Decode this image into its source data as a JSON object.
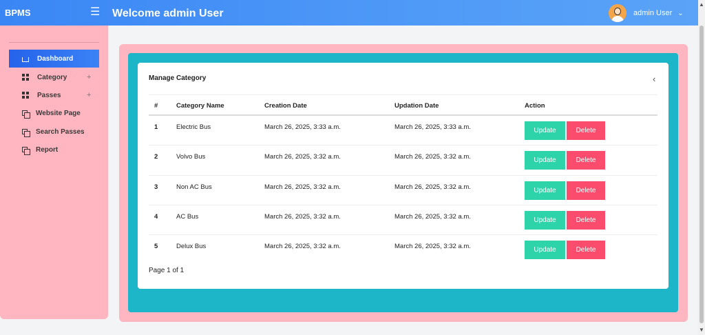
{
  "header": {
    "brand": "BPMS",
    "welcome": "Welcome  admin User",
    "user_name": "admin User"
  },
  "sidebar": {
    "items": [
      {
        "label": "Dashboard",
        "icon": "home-icon",
        "active": true
      },
      {
        "label": "Category",
        "icon": "grid-icon",
        "expandable": true
      },
      {
        "label": "Passes",
        "icon": "grid-icon",
        "expandable": true
      },
      {
        "label": "Website Page",
        "icon": "copy-icon"
      },
      {
        "label": "Search Passes",
        "icon": "copy-icon"
      },
      {
        "label": "Report",
        "icon": "copy-icon"
      }
    ],
    "plus": "+"
  },
  "card": {
    "title": "Manage Category",
    "columns": [
      "#",
      "Category Name",
      "Creation Date",
      "Updation Date",
      "Action"
    ],
    "rows": [
      {
        "num": "1",
        "name": "Electric Bus",
        "created": "March 26, 2025, 3:33 a.m.",
        "updated": "March 26, 2025, 3:33 a.m."
      },
      {
        "num": "2",
        "name": "Volvo Bus",
        "created": "March 26, 2025, 3:32 a.m.",
        "updated": "March 26, 2025, 3:32 a.m."
      },
      {
        "num": "3",
        "name": "Non AC Bus",
        "created": "March 26, 2025, 3:32 a.m.",
        "updated": "March 26, 2025, 3:32 a.m."
      },
      {
        "num": "4",
        "name": "AC Bus",
        "created": "March 26, 2025, 3:32 a.m.",
        "updated": "March 26, 2025, 3:32 a.m."
      },
      {
        "num": "5",
        "name": "Delux Bus",
        "created": "March 26, 2025, 3:32 a.m.",
        "updated": "March 26, 2025, 3:32 a.m."
      }
    ],
    "update_label": "Update",
    "delete_label": "Delete",
    "pagination": "Page 1 of 1"
  },
  "colors": {
    "header": "#3a86f5",
    "sidebar": "#ffb6c1",
    "teal": "#1db6c8",
    "update": "#2dd4a9",
    "delete": "#fb4c6e"
  }
}
